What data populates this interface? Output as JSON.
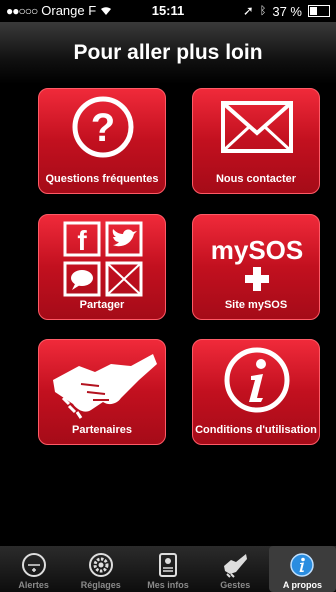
{
  "status_bar": {
    "carrier": "Orange F",
    "time": "15:11",
    "battery": "37 %",
    "battery_level": 0.37
  },
  "header": {
    "title": "Pour aller plus loin"
  },
  "tiles": [
    {
      "label": "Questions fréquentes",
      "icon": "question-icon"
    },
    {
      "label": "Nous contacter",
      "icon": "envelope-icon"
    },
    {
      "label": "Partager",
      "icon": "share-icon"
    },
    {
      "label": "Site mySOS",
      "logo": "mySOS",
      "icon": "mysos-logo"
    },
    {
      "label": "Partenaires",
      "icon": "handshake-icon"
    },
    {
      "label": "Conditions d'utilisation",
      "icon": "info-icon"
    }
  ],
  "tab_bar": [
    {
      "label": "Alertes",
      "icon": "sos-icon",
      "active": false
    },
    {
      "label": "Réglages",
      "icon": "gear-icon",
      "active": false
    },
    {
      "label": "Mes infos",
      "icon": "id-card-icon",
      "active": false
    },
    {
      "label": "Gestes",
      "icon": "hands-icon",
      "active": false
    },
    {
      "label": "A propos",
      "icon": "info-icon",
      "active": true
    }
  ]
}
